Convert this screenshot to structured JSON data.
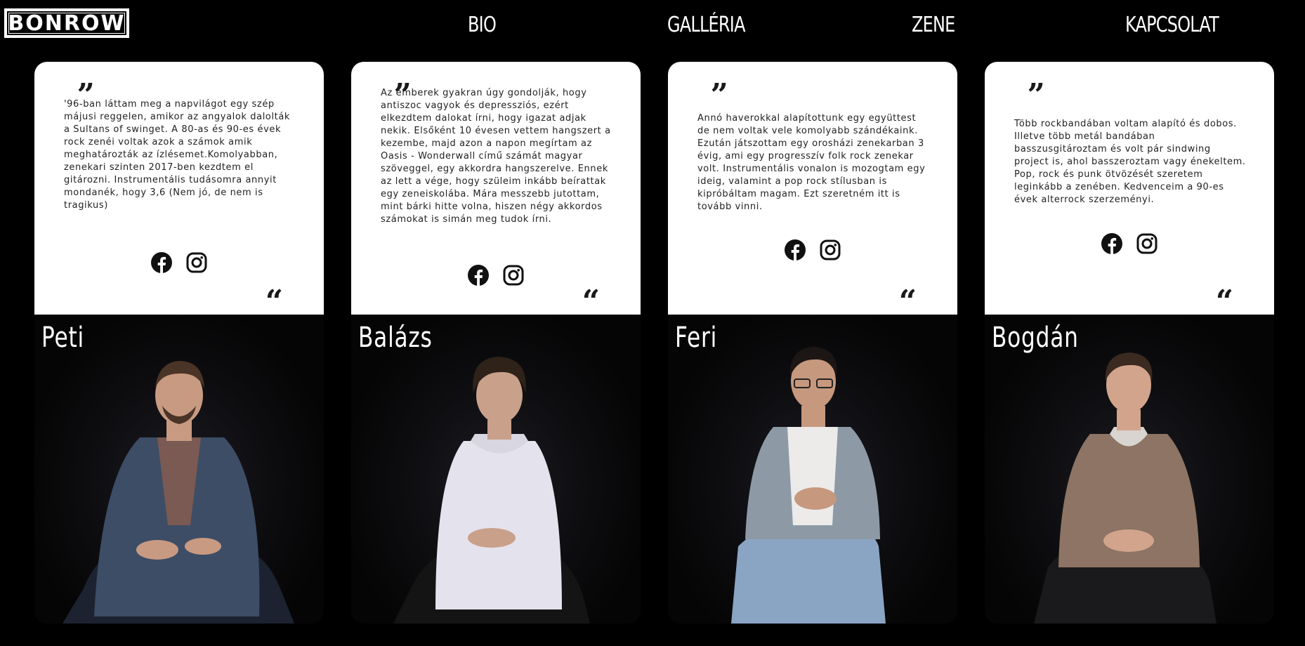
{
  "header": {
    "logo": "BONROW",
    "nav": [
      {
        "label": "BIO"
      },
      {
        "label": "GALLÉRIA"
      },
      {
        "label": "ZENE"
      },
      {
        "label": "KAPCSOLAT"
      }
    ]
  },
  "members": [
    {
      "name": "Peti",
      "bio": "'96-ban láttam meg a napvilágot egy szép májusi reggelen, amikor az angyalok dalolták a Sultans of swinget. A 80-as és 90-es évek rock zenéi voltak azok a számok amik meghatározták az ízlésemet.Komolyabban, zenekari szinten 2017-ben kezdtem el gitározni. Instrumentális tudásomra annyit mondanék, hogy 3,6 (Nem jó, de nem is tragikus)",
      "shirt": "#3d4d66",
      "inner": "#7a5a52",
      "pants": "#1c2230",
      "skin": "#c89a82",
      "hair": "#4a3427"
    },
    {
      "name": "Balázs",
      "bio": "Az emberek gyakran úgy gondolják, hogy antiszoc vagyok és depressziós, ezért elkezdtem dalokat írni, hogy igazat adjak nekik. Elsőként 10 évesen vettem hangszert a kezembe, majd azon a napon megírtam az Oasis - Wonderwall című számát magyar szöveggel, egy akkordra hangszerelve. Ennek az lett a vége, hogy szüleim inkább beírattak egy zeneiskolába. Mára messzebb jutottam, mint bárki hitte volna, hiszen négy akkordos számokat is simán meg tudok írni.",
      "shirt": "#e4e2ec",
      "inner": "#d8d6e0",
      "pants": "#141414",
      "skin": "#c9a08a",
      "hair": "#2e2219"
    },
    {
      "name": "Feri",
      "bio": "Annó haverokkal alapítottunk egy együttest de nem voltak vele komolyabb szándékaink. Ezután játszottam egy orosházi zenekarban 3 évig, ami egy progresszív folk rock zenekar volt. Instrumentális vonalon is mozogtam egy ideig, valamint a pop rock stílusban is kipróbáltam magam. Ezt szeretném itt is tovább vinni.",
      "shirt": "#8d9aa6",
      "inner": "#ecebea",
      "pants": "#8aa4c4",
      "skin": "#c6987e",
      "hair": "#1c1714"
    },
    {
      "name": "Bogdán",
      "bio": "Több rockbandában voltam alapító és dobos. Illetve több metál bandában basszusgitároztam és volt pár sindwing project is, ahol basszeroztam vagy énekeltem. Pop, rock és punk ötvözését szeretem leginkább a zenében. Kedvenceim a 90-es évek alterrock szerzeményi.",
      "shirt": "#8d7464",
      "inner": "#d9d4cf",
      "pants": "#1a1a1c",
      "skin": "#d2a48c",
      "hair": "#3a2a20"
    }
  ]
}
